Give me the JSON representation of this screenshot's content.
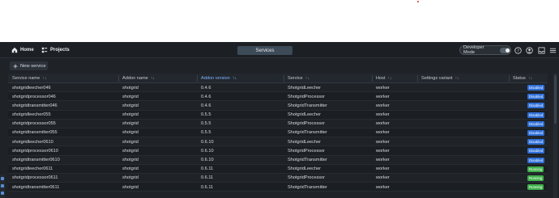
{
  "topbar": {
    "home_label": "Home",
    "projects_label": "Projects",
    "active_tab": "Services",
    "developer_mode_label": "Developer Mode"
  },
  "toolbar": {
    "new_service_label": "New service"
  },
  "table": {
    "columns": [
      "Service name",
      "Addon name",
      "Addon version",
      "Service",
      "Host",
      "Settings variant",
      "Status"
    ],
    "rows": [
      {
        "name": "shotgridleecher046",
        "addon": "shotgrid",
        "version": "0.4.6",
        "service": "ShotgridLeecher",
        "host": "worker",
        "status": "Disabled"
      },
      {
        "name": "shotgridprocessor046",
        "addon": "shotgrid",
        "version": "0.4.6",
        "service": "ShotgridProcessor",
        "host": "worker",
        "status": "Disabled"
      },
      {
        "name": "shotgridtransmitter046",
        "addon": "shotgrid",
        "version": "0.4.6",
        "service": "ShotgridTransmitter",
        "host": "worker",
        "status": "Disabled"
      },
      {
        "name": "shotgridleecher055",
        "addon": "shotgrid",
        "version": "0.5.5",
        "service": "ShotgridLeecher",
        "host": "worker",
        "status": "Disabled"
      },
      {
        "name": "shotgridprocessor055",
        "addon": "shotgrid",
        "version": "0.5.5",
        "service": "ShotgridProcessor",
        "host": "worker",
        "status": "Disabled"
      },
      {
        "name": "shotgridtransmitter055",
        "addon": "shotgrid",
        "version": "0.5.5",
        "service": "ShotgridTransmitter",
        "host": "worker",
        "status": "Disabled"
      },
      {
        "name": "shotgridleecher0610",
        "addon": "shotgrid",
        "version": "0.6.10",
        "service": "ShotgridLeecher",
        "host": "worker",
        "status": "Disabled"
      },
      {
        "name": "shotgridprocessor0610",
        "addon": "shotgrid",
        "version": "0.6.10",
        "service": "ShotgridProcessor",
        "host": "worker",
        "status": "Disabled"
      },
      {
        "name": "shotgridtransmitter0610",
        "addon": "shotgrid",
        "version": "0.6.10",
        "service": "ShotgridTransmitter",
        "host": "worker",
        "status": "Disabled"
      },
      {
        "name": "shotgridleecher0611",
        "addon": "shotgrid",
        "version": "0.6.11",
        "service": "ShotgridLeecher",
        "host": "worker",
        "status": "Running"
      },
      {
        "name": "shotgridprocessor0611",
        "addon": "shotgrid",
        "version": "0.6.11",
        "service": "ShotgridProcessor",
        "host": "worker",
        "status": "Running"
      },
      {
        "name": "shotgridtransmitter0611",
        "addon": "shotgrid",
        "version": "0.6.11",
        "service": "ShotgridTransmitter",
        "host": "worker",
        "status": "Running"
      }
    ]
  },
  "icons": {
    "home": "home-icon",
    "projects": "projects-icon",
    "help": "help-icon",
    "user": "user-icon",
    "inbox": "inbox-icon",
    "menu": "menu-icon",
    "add": "plus-icon",
    "sort": "sort-icon"
  },
  "colors": {
    "active_header": "#7fb3ff",
    "disabled_badge": "#2f6fd8",
    "running_badge": "#3fae4a",
    "active_tab_bg": "#3d4a58"
  }
}
